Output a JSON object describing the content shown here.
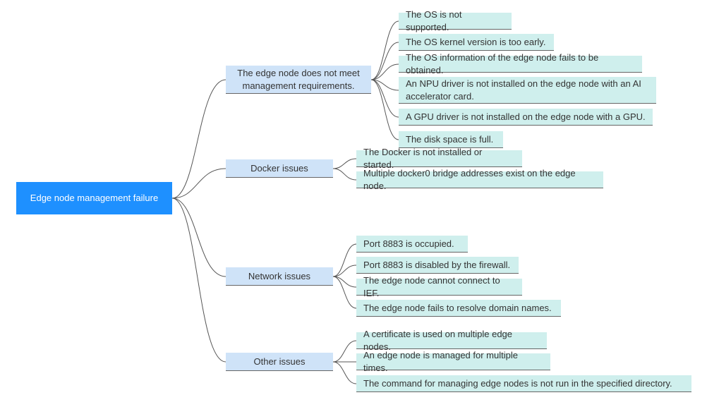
{
  "root": {
    "label": "Edge node management failure"
  },
  "branches": [
    {
      "label": "The edge node does not meet management requirements.",
      "leaves": [
        "The OS is not supported.",
        "The OS kernel version is too early.",
        "The OS information of the edge node fails to be obtained.",
        "An NPU driver is not installed on the edge node with an AI accelerator card.",
        "A GPU driver is not installed on the edge node with a GPU.",
        "The disk space is full."
      ]
    },
    {
      "label": "Docker issues",
      "leaves": [
        "The Docker is not installed or started.",
        "Multiple docker0 bridge addresses exist on the edge node."
      ]
    },
    {
      "label": "Network issues",
      "leaves": [
        "Port 8883 is occupied.",
        "Port 8883 is disabled by the firewall.",
        "The edge node cannot connect to IEF.",
        "The edge node fails to resolve domain names."
      ]
    },
    {
      "label": "Other issues",
      "leaves": [
        "A certificate is used on multiple edge nodes.",
        "An edge node is managed for multiple times.",
        "The command for managing edge nodes is not run in the specified directory."
      ]
    }
  ]
}
